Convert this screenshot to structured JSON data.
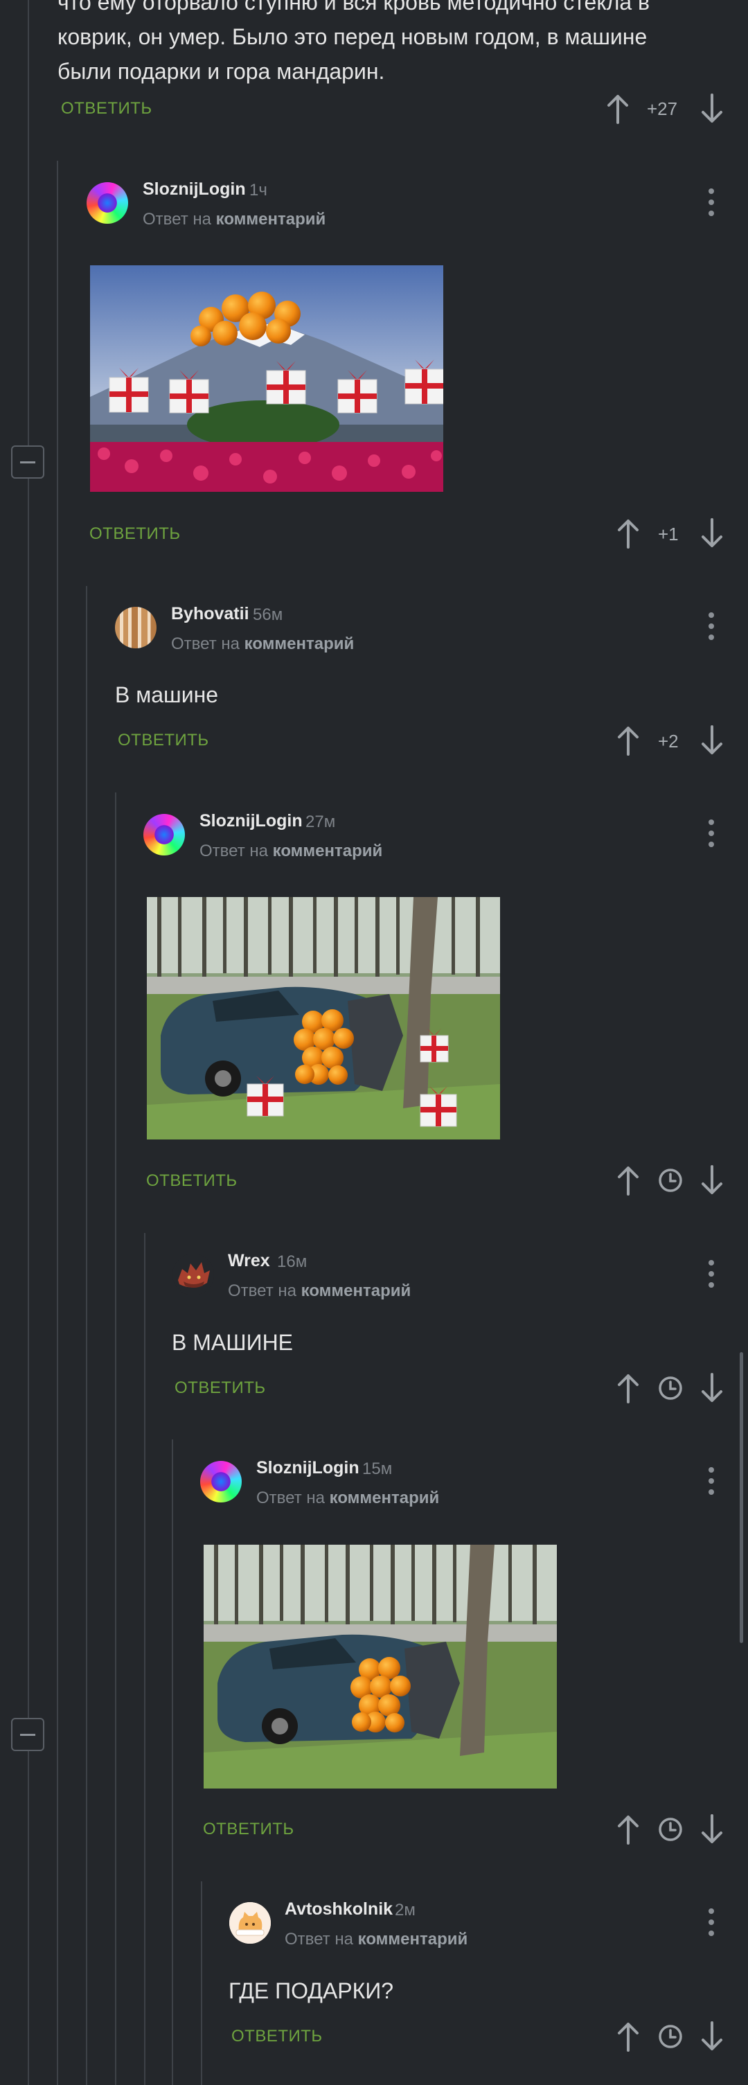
{
  "top_comment": {
    "text_line1": "что ему оторвало ступню и вся кровь методично стекла в",
    "text_line2": "коврик, он умер. Было это перед новым годом, в машине",
    "text_line3": "были подарки и гора мандарин.",
    "reply_label": "ОТВЕТИТЬ",
    "rating": "+27"
  },
  "comments": [
    {
      "author": "SloznijLogin",
      "time": "1ч",
      "reply_prefix": "Ответ на",
      "reply_target": "комментарий",
      "reply_label": "ОТВЕТИТЬ",
      "rating": "+1"
    },
    {
      "author": "Byhovatii",
      "time": "56м",
      "reply_prefix": "Ответ на",
      "reply_target": "комментарий",
      "text": "В машине",
      "reply_label": "ОТВЕТИТЬ",
      "rating": "+2"
    },
    {
      "author": "SloznijLogin",
      "time": "27м",
      "reply_prefix": "Ответ на",
      "reply_target": "комментарий",
      "reply_label": "ОТВЕТИТЬ"
    },
    {
      "author": "Wrex",
      "time": "16м",
      "reply_prefix": "Ответ на",
      "reply_target": "комментарий",
      "text": "В МАШИНЕ",
      "reply_label": "ОТВЕТИТЬ"
    },
    {
      "author": "SloznijLogin",
      "time": "15м",
      "reply_prefix": "Ответ на",
      "reply_target": "комментарий",
      "reply_label": "ОТВЕТИТЬ"
    },
    {
      "author": "Avtoshkolnik",
      "time": "2м",
      "reply_prefix": "Ответ на",
      "reply_target": "комментарий",
      "text": "ГДЕ ПОДАРКИ?",
      "reply_label": "ОТВЕТИТЬ"
    }
  ],
  "colors": {
    "background": "#24272b",
    "reply_link": "#6ea33f",
    "thread_line": "#3e4248"
  }
}
